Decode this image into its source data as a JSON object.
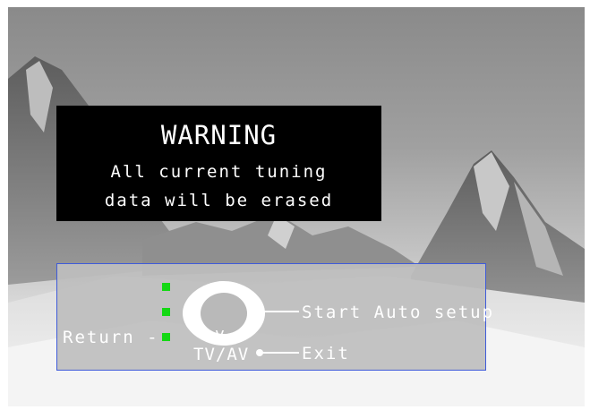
{
  "warning": {
    "title": "WARNING",
    "line1": "All current tuning",
    "line2": "data will be erased"
  },
  "controls": {
    "return_label": "Return -",
    "start_label": "Start Auto setup",
    "tvav_label": "TV/AV",
    "exit_label": "Exit",
    "up_symbol": "^",
    "down_symbol": "v",
    "minus_symbol": "-",
    "plus_symbol": "+"
  },
  "colors": {
    "led": "#14d814",
    "panel_border": "#3f5bd9",
    "warning_bg": "#000000"
  },
  "icons": [
    "remote-dpad-icon",
    "led-indicator-icon"
  ]
}
